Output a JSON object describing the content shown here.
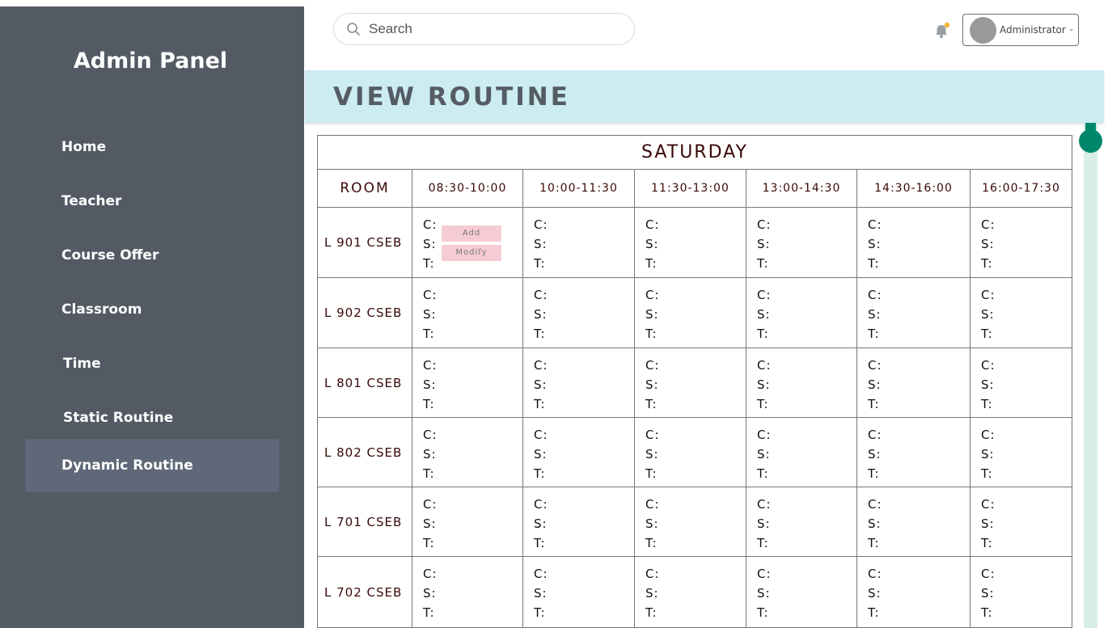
{
  "sidebar": {
    "brand": "Admin Panel",
    "items": [
      {
        "label": "Home"
      },
      {
        "label": "Teacher"
      },
      {
        "label": "Course Offer"
      },
      {
        "label": "Classroom"
      },
      {
        "label": "Time"
      },
      {
        "label": "Static Routine"
      },
      {
        "label": "Dynamic Routine",
        "active": true
      }
    ]
  },
  "header": {
    "search_placeholder": "Search",
    "user_label": "Administrator",
    "icons": [
      "search-icon",
      "bell-icon",
      "avatar",
      "chevron-down-icon"
    ]
  },
  "page": {
    "title": "VIEW ROUTINE"
  },
  "routine": {
    "day": "SATURDAY",
    "room_header": "ROOM",
    "time_slots": [
      "08:30-10:00",
      "10:00-11:30",
      "11:30-13:00",
      "13:00-14:30",
      "14:30-16:00",
      "16:00-17:30"
    ],
    "rooms": [
      "L 901 CSEB",
      "L 902 CSEB",
      "L 801 CSEB",
      "L 802 CSEB",
      "L 701 CSEB",
      "L 702 CSEB"
    ],
    "slot_fields": {
      "c": "C:",
      "s": "S:",
      "t": "T:"
    },
    "add_label": "Add",
    "modify_label": "Modify"
  },
  "colors": {
    "sidebar_bg": "#535a64",
    "sidebar_active": "#5f6878",
    "title_band": "#ccecf2",
    "accent_green": "#00876b",
    "notification_dot": "#f2b233",
    "button_pink": "#f6ccd4"
  }
}
